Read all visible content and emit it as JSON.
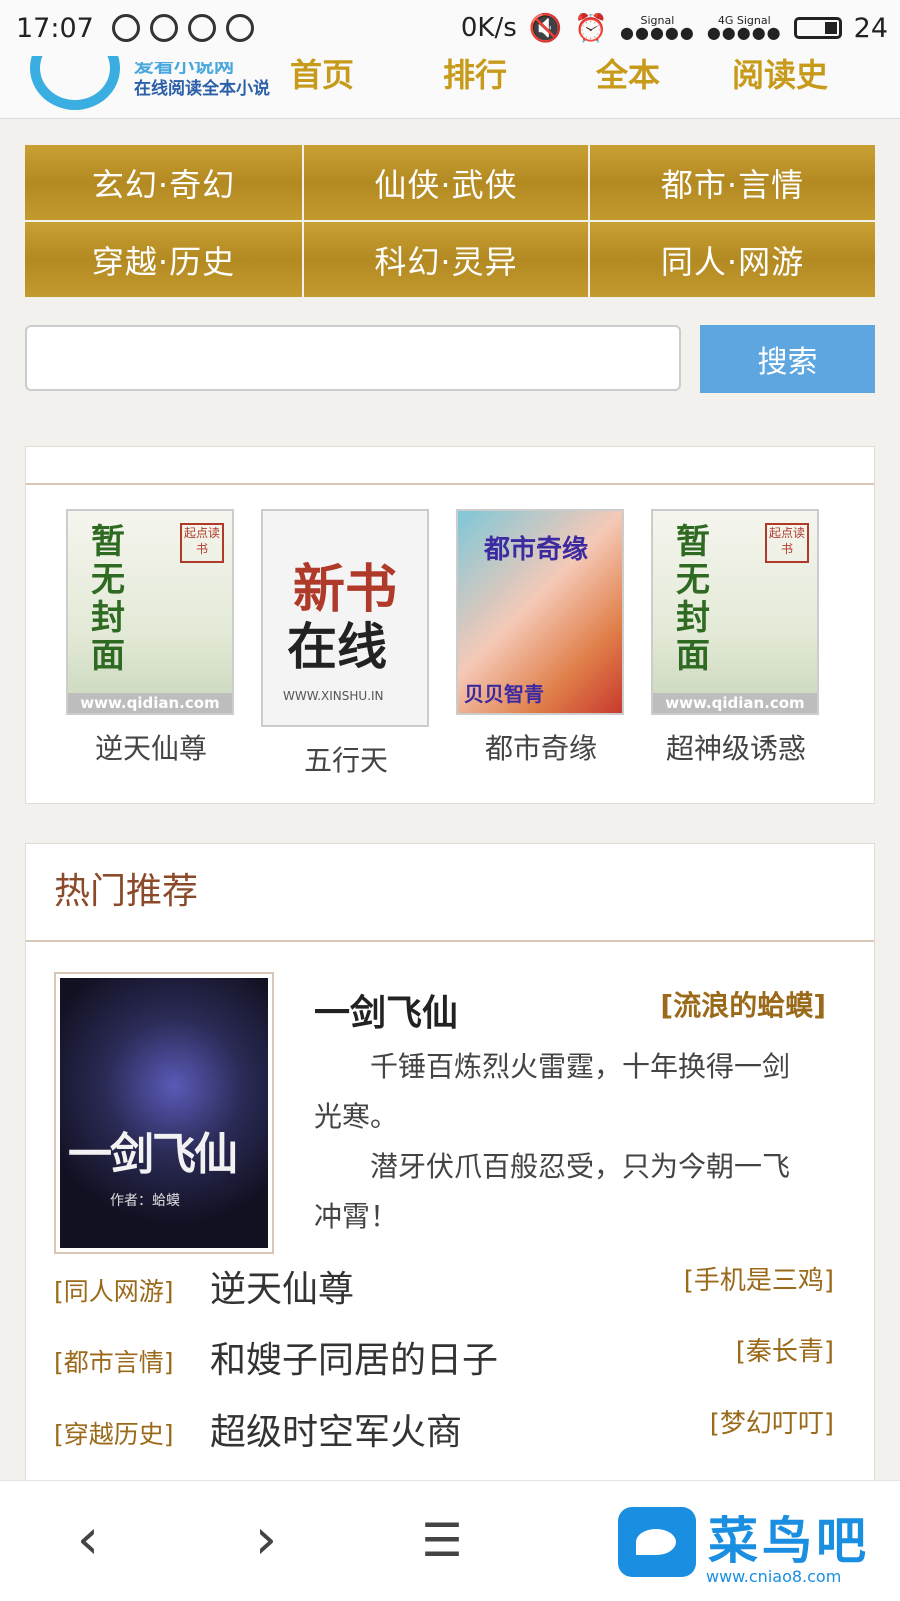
{
  "status_bar": {
    "time": "17:07",
    "speed": "0K/s",
    "signal1": "Signal",
    "signal2": "4G Signal",
    "battery": "24"
  },
  "header": {
    "logo_line1": "爱看小说网",
    "logo_line2": "在线阅读全本小说",
    "nav": [
      "首页",
      "排行",
      "全本",
      "阅读史"
    ]
  },
  "categories": [
    "玄幻·奇幻",
    "仙侠·武侠",
    "都市·言情",
    "穿越·历史",
    "科幻·灵异",
    "同人·网游"
  ],
  "search": {
    "button": "搜索",
    "placeholder": ""
  },
  "covers": [
    {
      "title": "逆天仙尊",
      "cover_text": "暂无封面",
      "cover_url": "www.qidian.com",
      "cover_stamp": "起点读书"
    },
    {
      "title": "五行天",
      "cover_text1": "新书",
      "cover_text2": "在线",
      "cover_url": "WWW.XINSHU.IN"
    },
    {
      "title": "都市奇缘",
      "cover_text": "都市奇缘",
      "cover_author": "贝贝智青"
    },
    {
      "title": "超神级诱惑",
      "cover_text": "暂无封面",
      "cover_url": "www.qidian.com",
      "cover_stamp": "起点读书"
    }
  ],
  "hot": {
    "heading": "热门推荐",
    "featured": {
      "title": "一剑飞仙",
      "author": "[流浪的蛤蟆]",
      "cover_title": "一剑飞仙",
      "cover_author": "作者：蛤蟆",
      "desc1": "千锤百炼烈火雷霆，十年换得一剑光寒。",
      "desc2": "潜牙伏爪百般忍受，只为今朝一飞冲霄！"
    },
    "list": [
      {
        "tag": "[同人网游]",
        "name": "逆天仙尊",
        "author": "[手机是三鸡]"
      },
      {
        "tag": "[都市言情]",
        "name": "和嫂子同居的日子",
        "author": "[秦长青]"
      },
      {
        "tag": "[穿越历史]",
        "name": "超级时空军火商",
        "author": "[梦幻叮叮]"
      }
    ]
  },
  "bottom_bar": {
    "back": "‹",
    "forward": "›",
    "menu": "☰"
  },
  "watermark": {
    "text": "菜鸟吧",
    "url": "www.cniao8.com"
  },
  "colors": {
    "gold": "#c0982b",
    "search_blue": "#5ea6df",
    "tag_brown": "#9a6a1a",
    "heading_brown": "#8b4a2a"
  }
}
